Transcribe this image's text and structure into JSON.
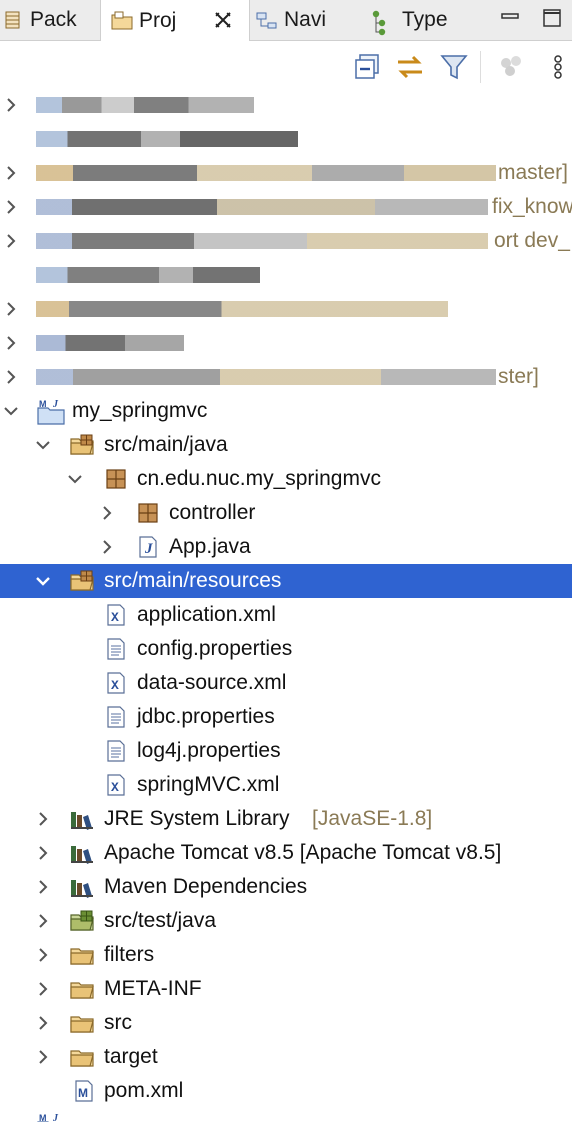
{
  "tabs": [
    {
      "label": "Pack",
      "icon": "package-explorer-icon"
    },
    {
      "label": "Proj",
      "icon": "project-explorer-icon",
      "active": true
    },
    {
      "label": "Navi",
      "icon": "navigator-icon"
    },
    {
      "label": "Type",
      "icon": "type-hierarchy-icon"
    }
  ],
  "toolbar": {
    "icons": [
      "collapse-all-icon",
      "link-with-editor-icon",
      "filter-icon",
      "dots-icon",
      "view-menu-icon"
    ]
  },
  "colors": {
    "selection": "#2f63d1",
    "decoration": "#8a7a55"
  },
  "tree": {
    "blurred": [
      {
        "suffix": ""
      },
      {
        "suffix": ""
      },
      {
        "suffix": "master]"
      },
      {
        "suffix": "fix_know"
      },
      {
        "suffix": "ort dev_"
      },
      {
        "suffix": ""
      },
      {
        "suffix": ""
      },
      {
        "suffix": ""
      },
      {
        "suffix": "ster]"
      }
    ],
    "project": {
      "label": "my_springmvc"
    },
    "src_main_java": {
      "label": "src/main/java"
    },
    "package": {
      "label": "cn.edu.nuc.my_springmvc"
    },
    "controller": {
      "label": "controller"
    },
    "app": {
      "label": "App.java"
    },
    "resources": {
      "label": "src/main/resources"
    },
    "files": [
      {
        "label": "application.xml",
        "icon": "xml-file-icon"
      },
      {
        "label": "config.properties",
        "icon": "text-file-icon"
      },
      {
        "label": "data-source.xml",
        "icon": "xml-file-icon"
      },
      {
        "label": "jdbc.properties",
        "icon": "text-file-icon"
      },
      {
        "label": "log4j.properties",
        "icon": "text-file-icon"
      },
      {
        "label": "springMVC.xml",
        "icon": "xml-file-icon"
      }
    ],
    "jre": {
      "label": "JRE System Library",
      "decoration": "[JavaSE-1.8]"
    },
    "tomcat": {
      "label": "Apache Tomcat v8.5 [Apache Tomcat v8.5]"
    },
    "maven": {
      "label": "Maven Dependencies"
    },
    "src_test_java": {
      "label": "src/test/java"
    },
    "folders": [
      {
        "label": "filters"
      },
      {
        "label": "META-INF"
      },
      {
        "label": "src"
      },
      {
        "label": "target"
      }
    ],
    "pom": {
      "label": "pom.xml"
    }
  }
}
